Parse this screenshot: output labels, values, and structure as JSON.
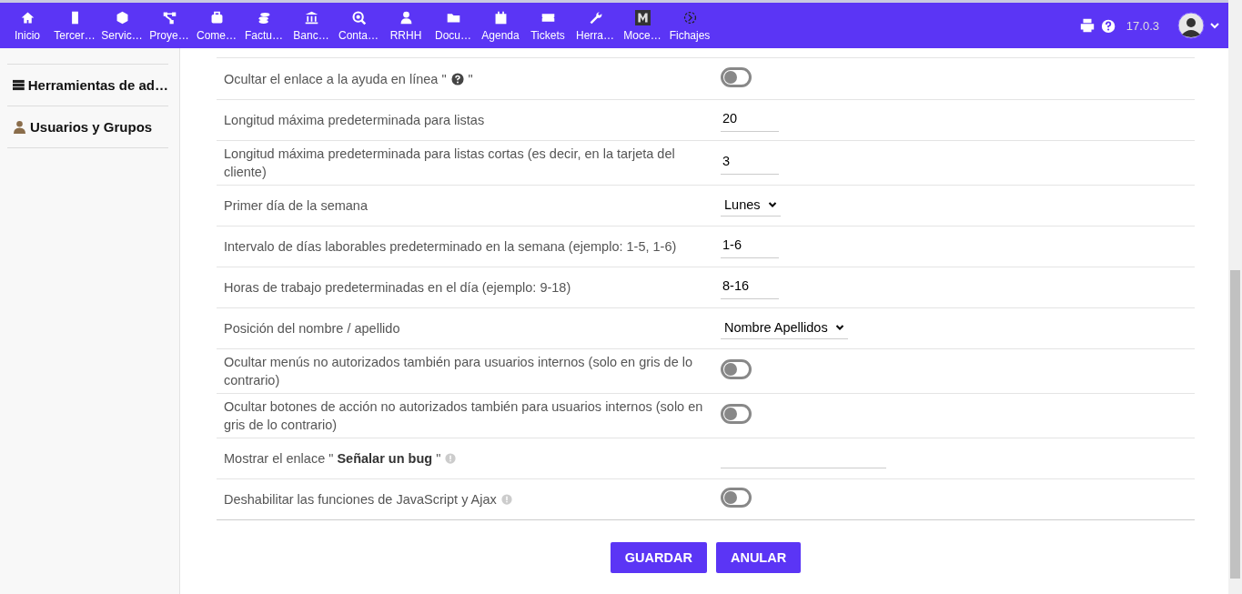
{
  "top_menu": [
    {
      "label": "Inicio"
    },
    {
      "label": "Tercer…"
    },
    {
      "label": "Servic…"
    },
    {
      "label": "Proye…"
    },
    {
      "label": "Come…"
    },
    {
      "label": "Factu…"
    },
    {
      "label": "Banc…"
    },
    {
      "label": "Conta…"
    },
    {
      "label": "RRHH"
    },
    {
      "label": "Docu…"
    },
    {
      "label": "Agenda"
    },
    {
      "label": "Tickets"
    },
    {
      "label": "Herra…"
    },
    {
      "label": "Moce…"
    },
    {
      "label": "Fichajes"
    }
  ],
  "version": "17.0.3",
  "sidebar": {
    "items": [
      {
        "label": "Herramientas de ad…"
      },
      {
        "label": "Usuarios y Grupos"
      }
    ]
  },
  "settings": [
    {
      "kind": "toggle",
      "label": "Ocultar el enlace a la ayuda en línea \"",
      "label_end": "\"",
      "on": false
    },
    {
      "kind": "input",
      "label": "Longitud máxima predeterminada para listas",
      "value": "20"
    },
    {
      "kind": "input",
      "label": "Longitud máxima predeterminada para listas cortas (es decir, en la tarjeta del cliente)",
      "value": "3"
    },
    {
      "kind": "select",
      "label": "Primer día de la semana",
      "value": "Lunes"
    },
    {
      "kind": "input",
      "label": "Intervalo de días laborables predeterminado en la semana (ejemplo: 1-5, 1-6)",
      "value": "1-6"
    },
    {
      "kind": "input",
      "label": "Horas de trabajo predeterminadas en el día (ejemplo: 9-18)",
      "value": "8-16"
    },
    {
      "kind": "select",
      "label": "Posición del nombre / apellido",
      "value": "Nombre Apellidos"
    },
    {
      "kind": "toggle",
      "label": "Ocultar menús no autorizados también para usuarios internos (solo en gris de lo contrario)",
      "on": false
    },
    {
      "kind": "toggle",
      "label": "Ocultar botones de acción no autorizados también para usuarios internos (solo en gris de lo contrario)",
      "on": false
    },
    {
      "kind": "wide_input",
      "label": "Mostrar el enlace \" **Señalar un bug** \""
    },
    {
      "kind": "toggle",
      "label": "Deshabilitar las funciones de JavaScript y Ajax",
      "on": false
    }
  ],
  "buttons": [
    "GUARDAR",
    "ANULAR"
  ]
}
